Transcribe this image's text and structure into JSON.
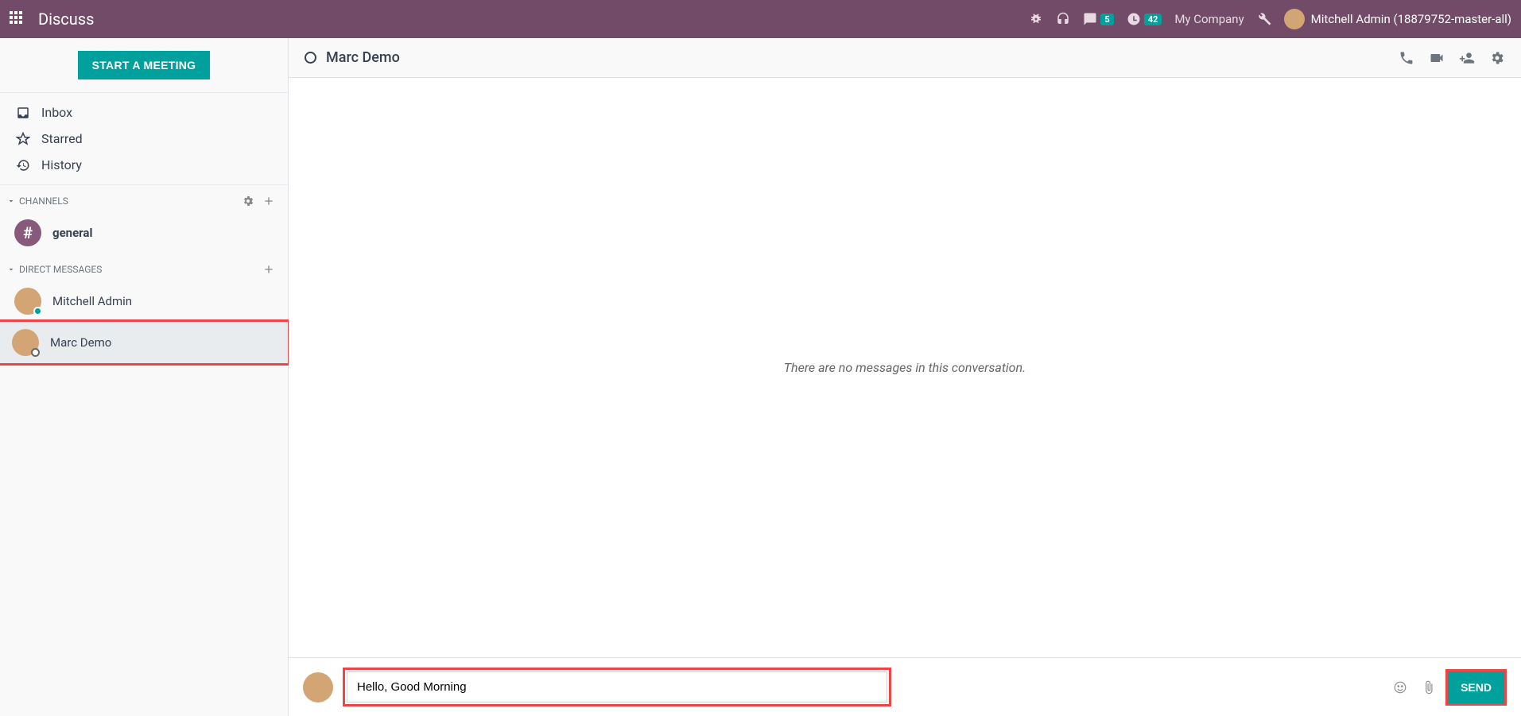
{
  "topbar": {
    "app_title": "Discuss",
    "messages_badge": "5",
    "activities_badge": "42",
    "company": "My Company",
    "user_display": "Mitchell Admin (18879752-master-all)"
  },
  "sidebar": {
    "start_meeting_label": "START A MEETING",
    "mailboxes": {
      "inbox": "Inbox",
      "starred": "Starred",
      "history": "History"
    },
    "channels_header": "CHANNELS",
    "channels": [
      {
        "name": "general"
      }
    ],
    "dm_header": "DIRECT MESSAGES",
    "direct_messages": [
      {
        "name": "Mitchell Admin",
        "presence": "online"
      },
      {
        "name": "Marc Demo",
        "presence": "offline",
        "active": true
      }
    ]
  },
  "chat": {
    "title": "Marc Demo",
    "empty_text": "There are no messages in this conversation.",
    "composer_value": "Hello, Good Morning",
    "send_label": "SEND"
  }
}
